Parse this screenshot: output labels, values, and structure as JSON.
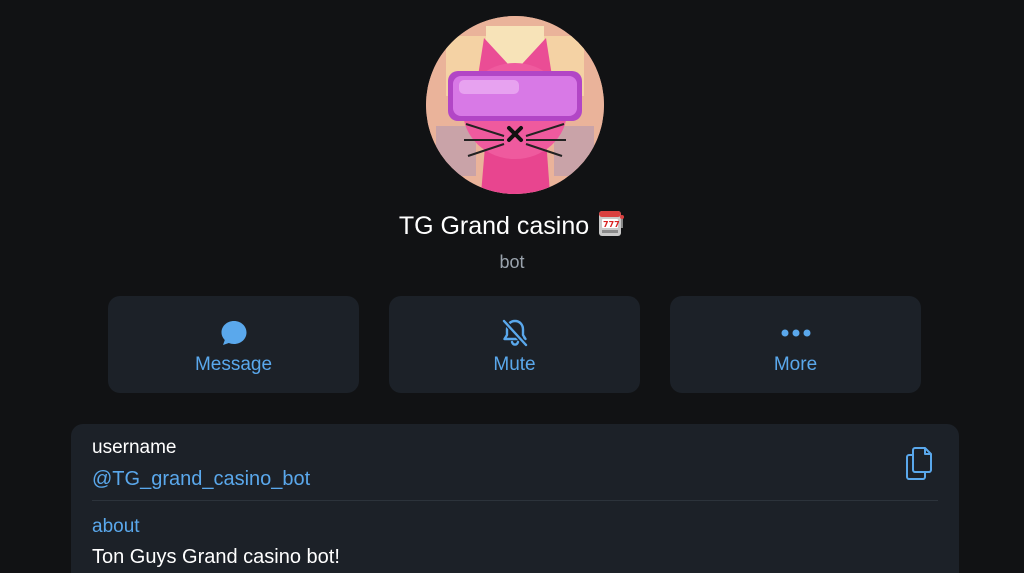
{
  "profile": {
    "name": "TG Grand casino",
    "type": "bot"
  },
  "actions": [
    {
      "label": "Message",
      "icon": "chat-bubble-icon"
    },
    {
      "label": "Mute",
      "icon": "bell-slash-icon"
    },
    {
      "label": "More",
      "icon": "ellipsis-icon"
    }
  ],
  "info": {
    "username_label": "username",
    "username_value": "@TG_grand_casino_bot",
    "about_label": "about",
    "about_value": "Ton Guys Grand casino bot!"
  },
  "colors": {
    "background": "#111214",
    "card": "#1c2128",
    "accent": "#5aa8ec",
    "secondary_text": "#9aa3ad"
  }
}
